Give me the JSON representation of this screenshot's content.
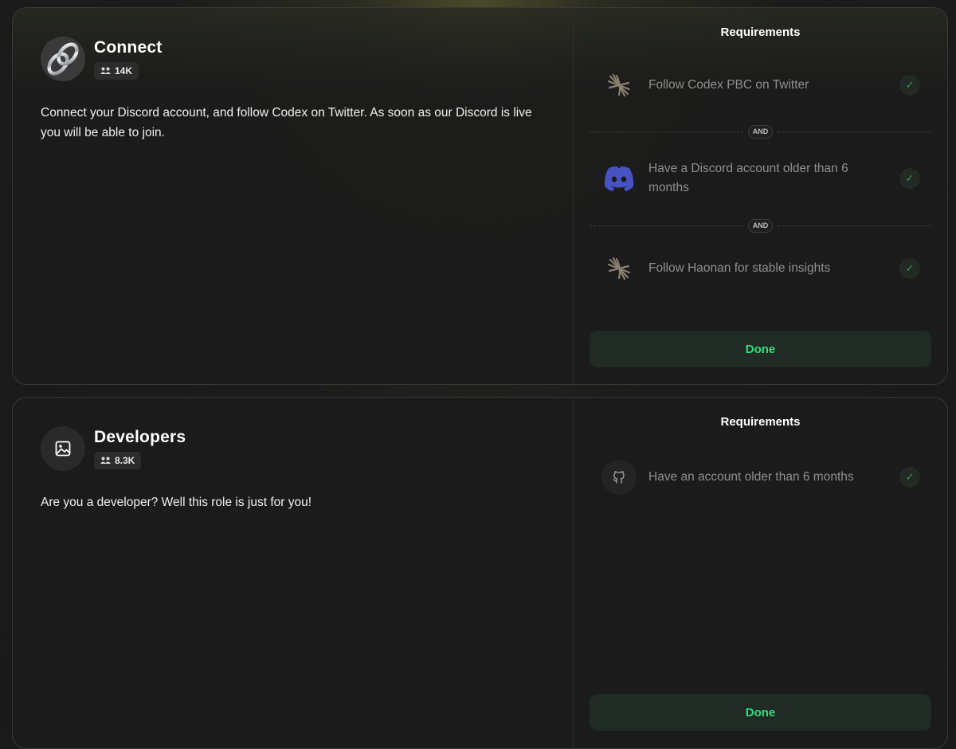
{
  "roles": [
    {
      "title": "Connect",
      "member_count": "14K",
      "description": "Connect your Discord account, and follow Codex on Twitter. As soon as our Discord is live you will be able to join.",
      "requirements_title": "Requirements",
      "requirements": [
        {
          "text": "Follow Codex PBC on Twitter",
          "icon": "codex-logo-icon"
        },
        {
          "text": "Have a Discord account older than 6 months",
          "icon": "discord-icon"
        },
        {
          "text": "Follow Haonan for stable insights",
          "icon": "codex-logo-icon"
        }
      ],
      "connector_label": "AND",
      "done_label": "Done"
    },
    {
      "title": "Developers",
      "member_count": "8.3K",
      "description": "Are you a developer? Well this role is just for you!",
      "requirements_title": "Requirements",
      "requirements": [
        {
          "text": "Have an account older than 6 months",
          "icon": "github-icon"
        }
      ],
      "done_label": "Done"
    }
  ],
  "colors": {
    "accent_green": "#2fe07a",
    "check_green": "#2f9e55",
    "discord_blurple": "#4752c4"
  }
}
